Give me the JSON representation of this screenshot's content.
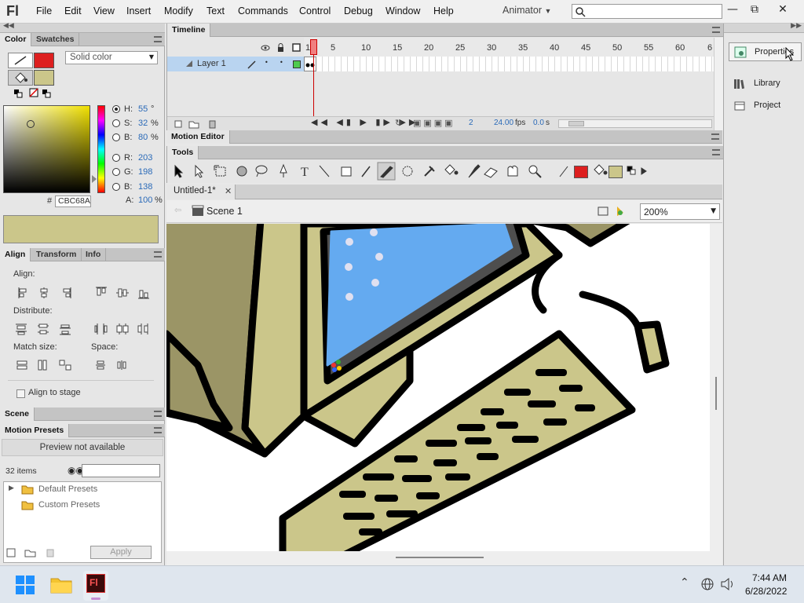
{
  "app": {
    "logo": "Fl",
    "menu": [
      "File",
      "Edit",
      "View",
      "Insert",
      "Modify",
      "Text",
      "Commands",
      "Control",
      "Debug",
      "Window",
      "Help"
    ],
    "workspace": "Animator",
    "window_buttons": [
      "—",
      "⧉",
      "✕"
    ]
  },
  "color_panel": {
    "tabs": [
      "Color",
      "Swatches"
    ],
    "fill_type": "Solid color",
    "h_label": "H:",
    "h_value": "55",
    "h_unit": "°",
    "s_label": "S:",
    "s_value": "32",
    "s_unit": "%",
    "b_label": "B:",
    "b_value": "80",
    "b_unit": "%",
    "r_label": "R:",
    "r_value": "203",
    "g_label": "G:",
    "g_value": "198",
    "bb_label": "B:",
    "bb_value": "138",
    "a_label": "A:",
    "a_value": "100",
    "a_unit": "%",
    "hex_label": "#",
    "hex_value": "CBC68A",
    "stroke_color": "#dd1f1f",
    "fill_color": "#cbc68a"
  },
  "align_panel": {
    "tabs": [
      "Align",
      "Transform",
      "Info"
    ],
    "align_label": "Align:",
    "distribute_label": "Distribute:",
    "match_size_label": "Match size:",
    "space_label": "Space:",
    "align_to_stage": "Align to stage"
  },
  "scene_panel": {
    "tab": "Scene"
  },
  "motion_presets": {
    "tab": "Motion Presets",
    "preview": "Preview not available",
    "count": "32 items",
    "folders": [
      "Default Presets",
      "Custom Presets"
    ],
    "apply": "Apply"
  },
  "timeline": {
    "tab": "Timeline",
    "layer": "Layer 1",
    "frame_numbers": [
      "1",
      "5",
      "10",
      "15",
      "20",
      "25",
      "30",
      "35",
      "40",
      "45",
      "50",
      "55",
      "60",
      "6"
    ],
    "current_frame": "2",
    "fps": "24.00",
    "fps_unit": "fps",
    "time": "0.0",
    "time_unit": "s"
  },
  "motion_editor": {
    "tab": "Motion Editor"
  },
  "tools": {
    "tab": "Tools",
    "stroke_color": "#dd1f1f",
    "fill_color": "#cbc68a"
  },
  "document": {
    "tab": "Untitled-1*",
    "scene": "Scene 1",
    "zoom": "200%"
  },
  "right_dock": {
    "items": [
      "Properties",
      "Library",
      "Project"
    ]
  },
  "taskbar": {
    "time": "7:44 AM",
    "date": "6/28/2022"
  }
}
